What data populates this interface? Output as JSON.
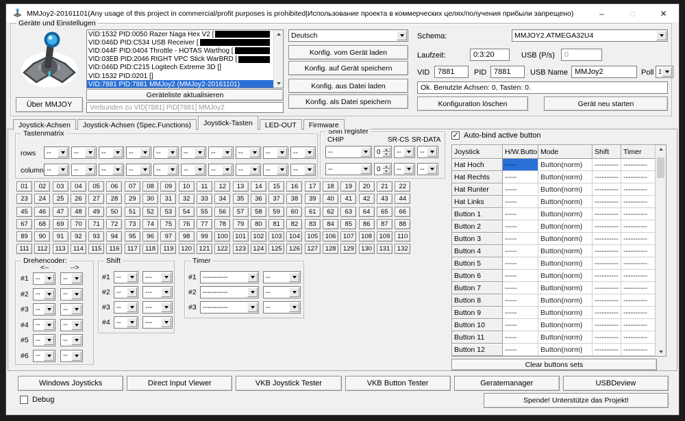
{
  "colors": {
    "accent": "#2a6fd6",
    "window_bg": "#f0f0f0",
    "titlebar_bg": "#ffffff",
    "desktop_bg": "#1b1b1d",
    "redaction": "#000000"
  },
  "icons": {
    "minimize": "–",
    "maximize": "□",
    "close": "✕",
    "checkmark": "✓"
  },
  "window": {
    "title": "MMJoy2-20161101(Any usage of this project in commercial/profit purposes is prohibited|Использование проекта в коммерческих целях/получения прибыли запрещено)"
  },
  "devices": {
    "group_label": "Geräte und Einstellugen",
    "list": [
      {
        "text": "VID:1532 PID:0050 Razer Naga Hex V2 [",
        "redacted": true
      },
      {
        "text": "VID:046D PID:C534 USB Receiver [",
        "redacted": true
      },
      {
        "text": "VID:044F PID:0404 Throttle - HOTAS Warthog [",
        "redacted": true
      },
      {
        "text": "VID:03EB PID:2046 RIGHT VPC Stick WarBRD [",
        "redacted": true
      },
      {
        "text": "VID:046D PID:C215 Logitech Extreme 3D []"
      },
      {
        "text": "VID:1532 PID:0201  []"
      },
      {
        "text": "VID:7881 PID:7881 MMJoy2 (MMJoy2-20161101)",
        "selected": true
      }
    ],
    "refresh_button": "Geräteliste aktualisieren",
    "about_button": "Über MMJOY",
    "connection_status": "Verbunden zu VID[7881] PID[7881] MMJoy2"
  },
  "config": {
    "language": "Deutsch",
    "buttons": [
      "Konfig. vom Gerät laden",
      "Konfig. auf Gerät speichern",
      "Konfig. aus Datei laden",
      "Konfig. als Datei speichern"
    ],
    "schema_label": "Schema:",
    "schema": "MMJOY2.ATMEGA32U4",
    "laufzeit_label": "Laufzeit:",
    "laufzeit": "0:3:20",
    "usb_ps_label": "USB (P/s)",
    "usb_ps": "0",
    "vid_label": "VID",
    "vid": "7881",
    "pid_label": "PID",
    "pid": "7881",
    "usb_name_label": "USB Name",
    "usb_name": "MMJoy2",
    "poll_label": "Poll",
    "poll": "1",
    "status": "Ok. Benutzte Achsen:  0, Tasten: 0.",
    "clear_button": "Konfiguration löschen",
    "restart_button": "Gerät neu starten"
  },
  "tabs": [
    {
      "label": "Joystick-Achsen"
    },
    {
      "label": "Joystick-Achsen (Spec.Functions)"
    },
    {
      "label": "Joystick-Tasten",
      "active": true
    },
    {
      "label": "LED-OUT"
    },
    {
      "label": "Firmware"
    }
  ],
  "tastenmatrix": {
    "group_label": "Tastenmatrix",
    "rows_label": "rows",
    "columns_label": "columns",
    "rows": [
      "--",
      "--",
      "--",
      "--",
      "--",
      "--",
      "--",
      "--",
      "--",
      "--"
    ],
    "columns": [
      "--",
      "--",
      "--",
      "--",
      "--",
      "--",
      "--",
      "--",
      "--",
      "--"
    ],
    "grid": [
      "01",
      "02",
      "03",
      "04",
      "05",
      "06",
      "07",
      "08",
      "09",
      "10",
      "11",
      "12",
      "13",
      "14",
      "15",
      "16",
      "17",
      "18",
      "19",
      "20",
      "21",
      "22",
      "23",
      "24",
      "25",
      "26",
      "27",
      "28",
      "29",
      "30",
      "31",
      "32",
      "33",
      "34",
      "35",
      "36",
      "37",
      "38",
      "39",
      "40",
      "41",
      "42",
      "43",
      "44",
      "45",
      "46",
      "47",
      "48",
      "49",
      "50",
      "51",
      "52",
      "53",
      "54",
      "55",
      "56",
      "57",
      "58",
      "59",
      "60",
      "61",
      "62",
      "63",
      "64",
      "65",
      "66",
      "67",
      "68",
      "69",
      "70",
      "71",
      "72",
      "73",
      "74",
      "75",
      "76",
      "77",
      "78",
      "79",
      "80",
      "81",
      "82",
      "83",
      "84",
      "85",
      "86",
      "87",
      "88",
      "89",
      "90",
      "91",
      "92",
      "93",
      "94",
      "95",
      "96",
      "97",
      "98",
      "99",
      "100",
      "101",
      "102",
      "103",
      "104",
      "105",
      "106",
      "107",
      "108",
      "109",
      "110",
      "111",
      "112",
      "113",
      "114",
      "115",
      "116",
      "117",
      "118",
      "119",
      "120",
      "121",
      "122",
      "123",
      "124",
      "125",
      "126",
      "127",
      "128",
      "129",
      "130",
      "131",
      "132"
    ]
  },
  "shift_register": {
    "group_label": "Shift register",
    "chip_label": "CHIP",
    "sr_cs_label": "SR-CS",
    "sr_data_label": "SR-DATA",
    "rows": [
      {
        "chip": "--",
        "count": "0",
        "cs": "--",
        "data": "--"
      },
      {
        "chip": "--",
        "count": "0",
        "cs": "--",
        "data": "--"
      }
    ]
  },
  "drehencoder": {
    "group_label": "Drehencoder:",
    "left_header": "<--",
    "right_header": "-->",
    "rows": [
      {
        "n": "#1",
        "l": "--",
        "r": "--"
      },
      {
        "n": "#2",
        "l": "--",
        "r": "--"
      },
      {
        "n": "#3",
        "l": "--",
        "r": "--"
      },
      {
        "n": "#4",
        "l": "--",
        "r": "--"
      },
      {
        "n": "#5",
        "l": "--",
        "r": "--"
      },
      {
        "n": "#6",
        "l": "--",
        "r": "--"
      }
    ]
  },
  "shift": {
    "group_label": "Shift",
    "rows": [
      {
        "n": "#1",
        "a": "--",
        "b": "---"
      },
      {
        "n": "#2",
        "a": "--",
        "b": "---"
      },
      {
        "n": "#3",
        "a": "--",
        "b": "---"
      },
      {
        "n": "#4",
        "a": "--",
        "b": "---"
      }
    ]
  },
  "timer": {
    "group_label": "Timer",
    "rows": [
      {
        "n": "#1",
        "a": "-----------",
        "b": "--"
      },
      {
        "n": "#2",
        "a": "-----------",
        "b": "--"
      },
      {
        "n": "#3",
        "a": "-----------",
        "b": "--"
      }
    ]
  },
  "bindings": {
    "autobind_label": "Auto-bind active button",
    "columns": [
      "Joystick",
      "H/W.Button",
      "Mode",
      "Shift",
      "Timer"
    ],
    "rows": [
      {
        "name": "Hat Hoch",
        "hw": "-----",
        "mode": "Button(norm)",
        "shift": "----------",
        "timer": "----------",
        "hw_selected": true
      },
      {
        "name": "Hat Rechts",
        "hw": "-----",
        "mode": "Button(norm)",
        "shift": "----------",
        "timer": "----------"
      },
      {
        "name": "Hat Runter",
        "hw": "-----",
        "mode": "Button(norm)",
        "shift": "----------",
        "timer": "----------"
      },
      {
        "name": "Hat Links",
        "hw": "-----",
        "mode": "Button(norm)",
        "shift": "----------",
        "timer": "----------"
      },
      {
        "name": "Button 1",
        "hw": "-----",
        "mode": "Button(norm)",
        "shift": "----------",
        "timer": "----------"
      },
      {
        "name": "Button 2",
        "hw": "-----",
        "mode": "Button(norm)",
        "shift": "----------",
        "timer": "----------"
      },
      {
        "name": "Button 3",
        "hw": "-----",
        "mode": "Button(norm)",
        "shift": "----------",
        "timer": "----------"
      },
      {
        "name": "Button 4",
        "hw": "-----",
        "mode": "Button(norm)",
        "shift": "----------",
        "timer": "----------"
      },
      {
        "name": "Button 5",
        "hw": "-----",
        "mode": "Button(norm)",
        "shift": "----------",
        "timer": "----------"
      },
      {
        "name": "Button 6",
        "hw": "-----",
        "mode": "Button(norm)",
        "shift": "----------",
        "timer": "----------"
      },
      {
        "name": "Button 7",
        "hw": "-----",
        "mode": "Button(norm)",
        "shift": "----------",
        "timer": "----------"
      },
      {
        "name": "Button 8",
        "hw": "-----",
        "mode": "Button(norm)",
        "shift": "----------",
        "timer": "----------"
      },
      {
        "name": "Button 9",
        "hw": "-----",
        "mode": "Button(norm)",
        "shift": "----------",
        "timer": "----------"
      },
      {
        "name": "Button 10",
        "hw": "-----",
        "mode": "Button(norm)",
        "shift": "----------",
        "timer": "----------"
      },
      {
        "name": "Button 11",
        "hw": "-----",
        "mode": "Button(norm)",
        "shift": "----------",
        "timer": "----------"
      },
      {
        "name": "Button 12",
        "hw": "-----",
        "mode": "Button(norm)",
        "shift": "----------",
        "timer": "----------"
      }
    ],
    "clear_button": "Clear buttons sets"
  },
  "footer": {
    "buttons": [
      "Windows Joysticks",
      "Direct Input Viewer",
      "VKB Joystick Tester",
      "VKB Button Tester",
      "Geratemanager",
      "USBDeview"
    ],
    "debug_label": "Debug",
    "donate_button": "Spende! Unterstütze das Projekt!"
  }
}
